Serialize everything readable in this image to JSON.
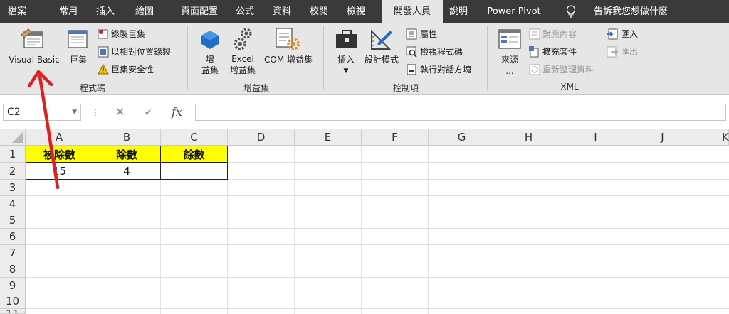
{
  "tabs": [
    "檔案",
    "常用",
    "插入",
    "繪圖",
    "頁面配置",
    "公式",
    "資料",
    "校閱",
    "檢視",
    "開發人員",
    "說明",
    "Power Pivot",
    "告訴我您想做什麼"
  ],
  "ribbon": {
    "code": {
      "label": "程式碼",
      "visual_basic": "Visual Basic",
      "macros": "巨集",
      "record_macro": "錄製巨集",
      "relative_refs": "以相對位置錄製",
      "macro_security": "巨集安全性"
    },
    "addins": {
      "label": "增益集",
      "addins_line1": "增",
      "addins_line2": "益集",
      "excel_addins_line1": "Excel",
      "excel_addins_line2": "增益集",
      "com_addins": "COM 增益集"
    },
    "controls": {
      "label": "控制項",
      "insert": "插入",
      "design_mode": "設計模式",
      "properties": "屬性",
      "view_code": "檢視程式碼",
      "run_dialog": "執行對話方塊"
    },
    "xml": {
      "label": "XML",
      "source_line1": "來源",
      "source_line2": "...",
      "map_properties": "對應內容",
      "expansion_packs": "擴充套件",
      "refresh_data": "重新整理資料",
      "import": "匯入",
      "export": "匯出"
    }
  },
  "formula_bar": {
    "name_box": "C2",
    "cancel": "✕",
    "enter": "✓",
    "fx": "fx",
    "value": ""
  },
  "sheet": {
    "columns": [
      "A",
      "B",
      "C",
      "D",
      "E",
      "F",
      "G",
      "H",
      "I",
      "J",
      "K"
    ],
    "rows": [
      "1",
      "2",
      "3",
      "4",
      "5",
      "6",
      "7",
      "8",
      "9",
      "10",
      "11"
    ],
    "cells": {
      "A1": "被除數",
      "B1": "除數",
      "C1": "餘數",
      "A2": "15",
      "B2": "4",
      "C2": ""
    }
  },
  "colors": {
    "tab_bar": "#3a3a3a",
    "ribbon": "#e6e6e6",
    "header_fill": "#ffff00",
    "annotation_arrow": "#e02020"
  }
}
